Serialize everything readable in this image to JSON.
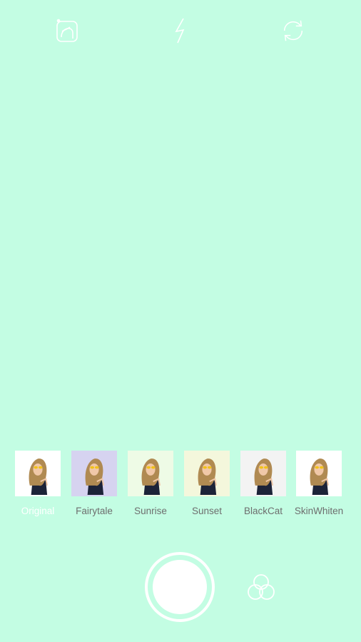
{
  "toolbar": {
    "icons": [
      "beauty-face-icon",
      "flash-icon",
      "switch-camera-icon"
    ]
  },
  "filters": [
    {
      "label": "Original",
      "selected": true,
      "bg": "#ffffff"
    },
    {
      "label": "Fairytale",
      "selected": false,
      "bg": "#d6d3f0"
    },
    {
      "label": "Sunrise",
      "selected": false,
      "bg": "#eefbe6"
    },
    {
      "label": "Sunset",
      "selected": false,
      "bg": "#f4f7dc"
    },
    {
      "label": "BlackCat",
      "selected": false,
      "bg": "#f3f3f3"
    },
    {
      "label": "SkinWhiten",
      "selected": false,
      "bg": "#ffffff"
    }
  ],
  "controls": {
    "shutter_icon": "shutter-button",
    "filter_icon": "filter-circles-icon"
  },
  "colors": {
    "background": "#c3fde3",
    "accent": "#ffffff",
    "label": "#6e6e6e"
  }
}
